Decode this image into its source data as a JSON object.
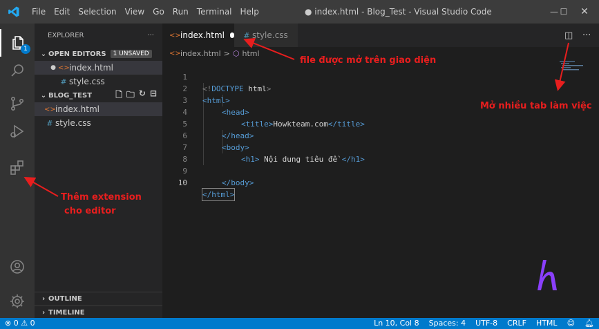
{
  "titlebar": {
    "menu": [
      "File",
      "Edit",
      "Selection",
      "View",
      "Go",
      "Run",
      "Terminal",
      "Help"
    ],
    "title": "● index.html - Blog_Test - Visual Studio Code",
    "minimize_icon": "—",
    "maximize_icon": "☐",
    "close_icon": "✕"
  },
  "activity_badge": "1",
  "sidebar": {
    "header": "EXPLORER",
    "header_more": "···",
    "open_editors": "OPEN EDITORS",
    "unsaved": "1 UNSAVED",
    "open_files": [
      "index.html",
      "style.css"
    ],
    "folder": "BLOG_TEST",
    "files": [
      "index.html",
      "style.css"
    ],
    "outline": "OUTLINE",
    "timeline": "TIMELINE"
  },
  "tabs": [
    {
      "label": "index.html",
      "modified": true
    },
    {
      "label": "style.css",
      "modified": false
    }
  ],
  "breadcrumb": {
    "file": "index.html",
    "symbol": "html",
    "sep": ">"
  },
  "code": {
    "line_numbers": [
      "1",
      "2",
      "3",
      "4",
      "5",
      "6",
      "7",
      "8",
      "9",
      "10"
    ],
    "doctype_open": "<!",
    "doctype_kw": "DOCTYPE",
    "doctype_val": "html",
    "doctype_close": ">",
    "html_open": "<html>",
    "head_open": "<head>",
    "title_open": "<title>",
    "title_text": "Howkteam.com",
    "title_close": "</title>",
    "head_close": "</head>",
    "body_open": "<body>",
    "h1_open": "<h1>",
    "h1_text": " Nội dung tiêu đề ",
    "h1_close": "</h1>",
    "body_close": "</body>",
    "html_close": "</html>"
  },
  "annotations": {
    "file_open": "file được mở trên giao diện",
    "multi_tab": "Mở nhiều tab làm việc",
    "extension_1": "Thêm extension",
    "extension_2": "cho editor"
  },
  "status": {
    "errors": "⊗ 0",
    "warnings": "⚠ 0",
    "position": "Ln 10, Col 8",
    "spaces": "Spaces: 4",
    "encoding": "UTF-8",
    "eol": "CRLF",
    "language": "HTML"
  },
  "colors": {
    "accent": "#007acc",
    "annotation": "#e81e1e",
    "logo": "#8a3ffc"
  }
}
